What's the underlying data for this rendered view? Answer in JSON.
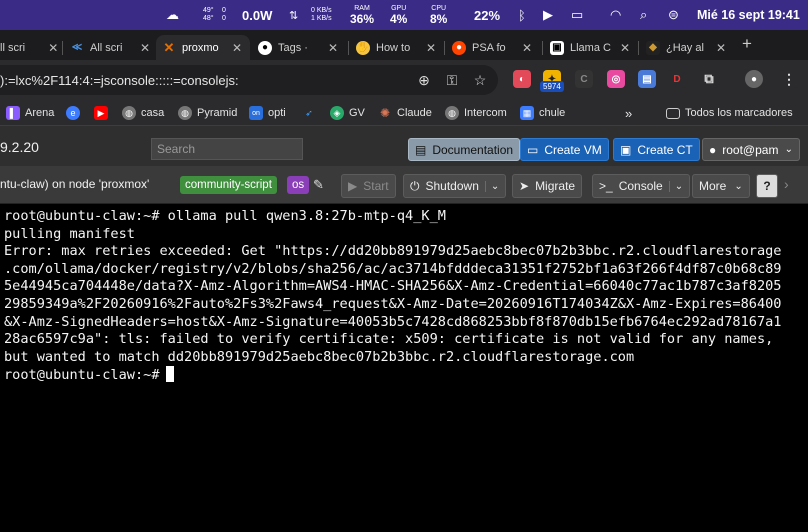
{
  "menubar": {
    "temps": [
      "49°",
      "48°"
    ],
    "temps_sub": [
      "0",
      "0"
    ],
    "power": "0.0W",
    "net": [
      "0 KB/s",
      "1 KB/s"
    ],
    "ram_label": "RAM",
    "ram": "36%",
    "gpu_label": "GPU",
    "gpu": "4%",
    "cpu_label": "CPU",
    "cpu": "8%",
    "battery": "22%",
    "datetime": "Mié 16 sept 19:41"
  },
  "tabs": [
    {
      "title": "ll scri",
      "icon": "chevron-icon",
      "color": "#4a90e2"
    },
    {
      "title": "All scri",
      "icon": "chevron-icon",
      "color": "#4a90e2"
    },
    {
      "title": "proxmo",
      "icon": "proxmox-icon",
      "color": "#e57000",
      "active": true
    },
    {
      "title": "Tags ·",
      "icon": "github-icon",
      "color": "#ffffff"
    },
    {
      "title": "How to",
      "icon": "how-icon",
      "color": "#f5c542"
    },
    {
      "title": "PSA fo",
      "icon": "reddit-icon",
      "color": "#ff4500"
    },
    {
      "title": "Llama C",
      "icon": "llama-icon",
      "color": "#ffffff"
    },
    {
      "title": "¿Hay al",
      "icon": "chatgpt-icon",
      "color": "#222222"
    }
  ],
  "address": {
    "url": "):=lxc%2F114:4:=jsconsole:::::=consolejs:"
  },
  "extensions": {
    "badge": "5974"
  },
  "bookmarks": [
    {
      "label": "Arena",
      "color": "#8a5cff"
    },
    {
      "label": "",
      "color": "#3d7bff"
    },
    {
      "label": "",
      "color": "#ff0000"
    },
    {
      "label": "casa",
      "color": "#888888"
    },
    {
      "label": "Pyramid",
      "color": "#888888"
    },
    {
      "label": "opti",
      "color": "#2a6edb"
    },
    {
      "label": "",
      "color": "#3aa0ff"
    },
    {
      "label": "GV",
      "color": "#2aa86a"
    },
    {
      "label": "Claude",
      "color": "#d97757"
    },
    {
      "label": "Intercom",
      "color": "#888888"
    },
    {
      "label": "chule",
      "color": "#3d7bff"
    },
    {
      "label": "Todos los marcadores",
      "color": "#cccccc"
    }
  ],
  "proxmox": {
    "version": "9.2.20",
    "search_placeholder": "Search",
    "documentation": "Documentation",
    "create_vm": "Create VM",
    "create_ct": "Create CT",
    "user": "root@pam",
    "node_title": "ntu-claw) on node 'proxmox'",
    "tags": [
      {
        "label": "community-script",
        "color": "#3f8f3f"
      },
      {
        "label": "os",
        "color": "#8a3fb8"
      }
    ],
    "start": "Start",
    "shutdown": "Shutdown",
    "migrate": "Migrate",
    "console": "Console",
    "more": "More"
  },
  "terminal": {
    "lines": [
      "root@ubuntu-claw:~# ollama pull qwen3.8:27b-mtp-q4_K_M",
      "pulling manifest",
      "Error: max retries exceeded: Get \"https://dd20bb891979d25aebc8bec07b2b3bbc.r2.cloudflarestorage",
      ".com/ollama/docker/registry/v2/blobs/sha256/ac/ac3714bfdddeca31351f2752bf1a63f266f4df87c0b68c89",
      "5e44945ca704448e/data?X-Amz-Algorithm=AWS4-HMAC-SHA256&X-Amz-Credential=66040c77ac1b787c3af8205",
      "29859349a%2F20260916%2Fauto%2Fs3%2Faws4_request&X-Amz-Date=20260916T174034Z&X-Amz-Expires=86400",
      "&X-Amz-SignedHeaders=host&X-Amz-Signature=40053b5c7428cd868253bbf8f870db15efb6764ec292ad78167a1",
      "28ac6597c9a\": tls: failed to verify certificate: x509: certificate is not valid for any names,",
      "but wanted to match dd20bb891979d25aebc8bec07b2b3bbc.r2.cloudflarestorage.com"
    ],
    "prompt": "root@ubuntu-claw:~#"
  }
}
